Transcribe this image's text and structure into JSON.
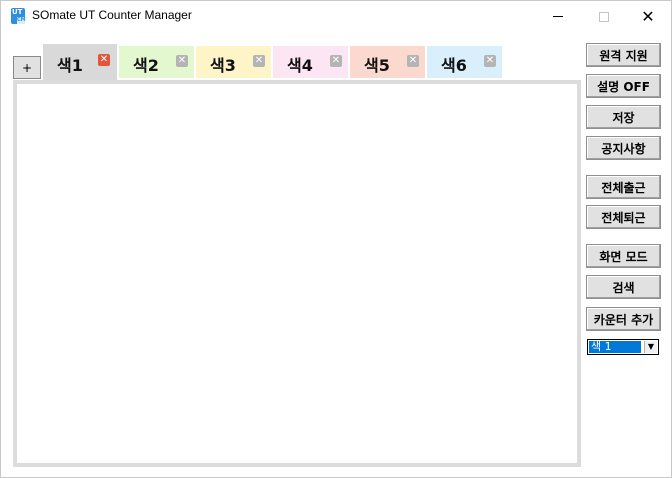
{
  "window": {
    "title": "SOmate UT Counter Manager",
    "icon_top": "UT",
    "icon_bottom": "CM",
    "minimize_label": "",
    "close_glyph": "✕"
  },
  "add_tab_label": "+",
  "tabs": [
    {
      "label": "색1",
      "color": "#d9d9d9",
      "close_color": "#e0573c",
      "active": true
    },
    {
      "label": "색2",
      "color": "#e3f8cf",
      "close_color": "#b4b4b4",
      "active": false
    },
    {
      "label": "색3",
      "color": "#fdf4c8",
      "close_color": "#b4b4b4",
      "active": false
    },
    {
      "label": "색4",
      "color": "#fde6f4",
      "close_color": "#b4b4b4",
      "active": false
    },
    {
      "label": "색5",
      "color": "#fcd9cf",
      "close_color": "#b4b4b4",
      "active": false
    },
    {
      "label": "색6",
      "color": "#d9f0fc",
      "close_color": "#b4b4b4",
      "active": false
    }
  ],
  "tab_close_glyph": "✕",
  "side_buttons": {
    "remote_support": "원격 지원",
    "description_off": "설명 OFF",
    "save": "저장",
    "notices": "공지사항",
    "check_in_all": "전체출근",
    "check_out_all": "전체퇴근",
    "screen_mode": "화면 모드",
    "search": "검색",
    "add_counter": "카운터 추가"
  },
  "color_select": {
    "value": "색 1",
    "arrow": "▼"
  }
}
